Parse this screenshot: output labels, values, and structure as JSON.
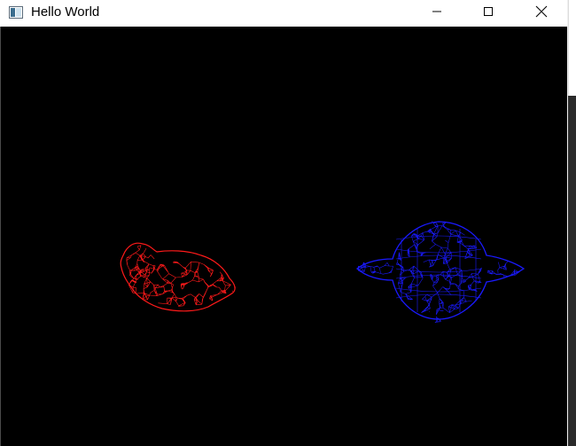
{
  "window": {
    "title": "Hello World",
    "app_icon": "window-app-icon",
    "controls": {
      "minimize_icon": "minimize-icon",
      "maximize_icon": "maximize-icon",
      "close_icon": "close-icon"
    }
  },
  "scene": {
    "background": "#000000",
    "objects": [
      {
        "name": "bunny-mesh",
        "render": "wireframe",
        "color": "#ff0000"
      },
      {
        "name": "spiky-mesh",
        "render": "wireframe",
        "color": "#0000ff"
      }
    ]
  },
  "colors": {
    "titlebar_bg": "#ffffff",
    "viewport_bg": "#000000",
    "red_wire": "#ff1a1a",
    "blue_wire": "#1a1aff"
  }
}
